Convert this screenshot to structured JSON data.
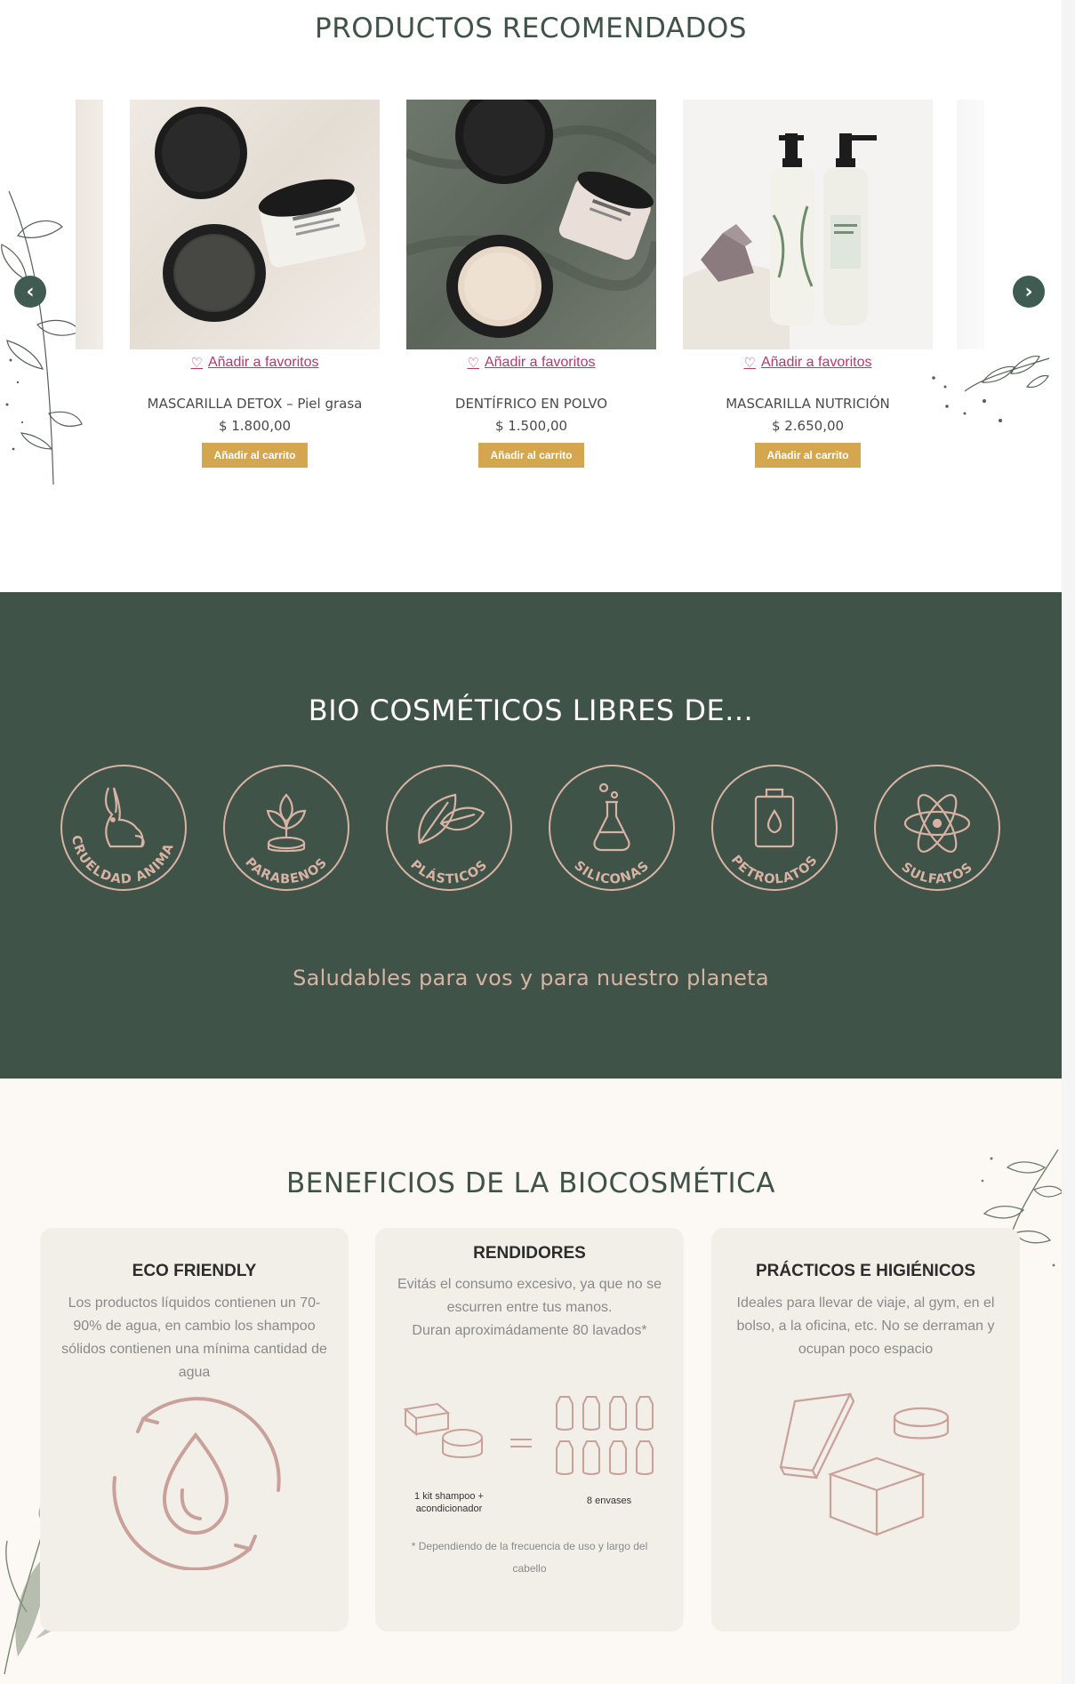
{
  "products_section": {
    "title": "PRODUCTOS RECOMENDADOS",
    "items": [
      {
        "fav_label": "Añadir a favoritos",
        "name": "MASCARILLA DETOX – Piel grasa",
        "price": "$ 1.800,00",
        "cart_label": "Añadir al carrito"
      },
      {
        "fav_label": "Añadir a favoritos",
        "name": "DENTÍFRICO EN POLVO",
        "price": "$ 1.500,00",
        "cart_label": "Añadir al carrito"
      },
      {
        "fav_label": "Añadir a favoritos",
        "name": "MASCARILLA NUTRICIÓN",
        "price": "$ 2.650,00",
        "cart_label": "Añadir al carrito"
      }
    ],
    "colors": {
      "accent": "#d4a64f",
      "link": "#b03a6e",
      "arrow": "#3f5b52"
    }
  },
  "bio_section": {
    "title": "BIO COSMÉTICOS LIBRES DE...",
    "badges": [
      "CRUELDAD ANIMAL",
      "PARABENOS",
      "PLÁSTICOS",
      "SILICONAS",
      "PETROLATOS",
      "SULFATOS"
    ],
    "badge_icons": [
      "rabbit-icon",
      "sprout-icon",
      "leaf-icon",
      "flask-icon",
      "oil-can-icon",
      "atom-icon"
    ],
    "tagline": "Saludables para vos y para nuestro planeta",
    "colors": {
      "background": "#3f5348",
      "accent": "#d8b3a4"
    }
  },
  "benefits_section": {
    "title": "BENEFICIOS DE LA BIOCOSMÉTICA",
    "cards": [
      {
        "title": "ECO FRIENDLY",
        "text": "Los productos líquidos contienen un 70-90% de agua, en cambio los shampoo sólidos contienen una mínima cantidad de agua"
      },
      {
        "title": "RENDIDORES",
        "text": "Evitás el consumo excesivo, ya que no se escurren entre tus manos.",
        "text2": "Duran aproximádamente 80 lavados*",
        "left_caption": "1 kit shampoo + acondicionador",
        "right_caption": "8 envases",
        "note": "* Dependiendo de la frecuencia de uso y largo del cabello"
      },
      {
        "title": "PRÁCTICOS E HIGIÉNICOS",
        "text": "Ideales para llevar de viaje, al gym, en el bolso, a la oficina, etc. No se derraman y ocupan poco espacio"
      }
    ],
    "colors": {
      "background": "#fcf8f4",
      "card": "#f2efe8",
      "illustration": "#c9a09a"
    }
  }
}
